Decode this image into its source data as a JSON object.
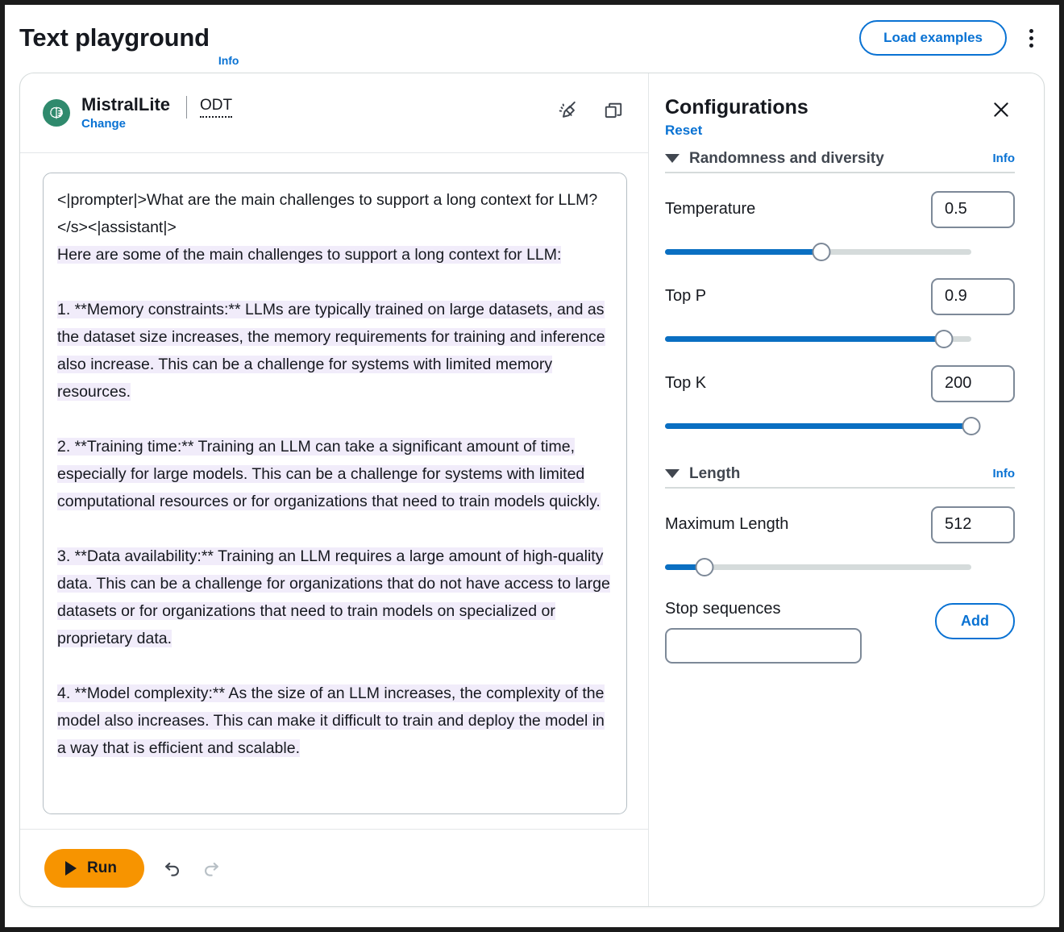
{
  "header": {
    "title": "Text playground",
    "info_label": "Info",
    "load_examples_label": "Load examples",
    "kebab_icon": "more-vertical-icon"
  },
  "model": {
    "icon": "model-brain-icon",
    "name": "MistralLite",
    "change_label": "Change",
    "badge": "ODT",
    "clear_icon": "broom-icon",
    "copy_icon": "copy-icon"
  },
  "editor": {
    "prompt_lines": [
      "<|prompter|>What are the main challenges to support a long context for LLM?</s><|assistant|>"
    ],
    "completion_paragraphs": [
      " Here are some of the main challenges to support a long context for LLM:",
      "1. **Memory constraints:** LLMs are typically trained on large datasets, and as the dataset size increases, the memory requirements for training and inference also increase. This can be a challenge for systems with limited memory resources.",
      "2. **Training time:** Training an LLM can take a significant amount of time, especially for large models. This can be a challenge for systems with limited computational resources or for organizations that need to train models quickly.",
      "3. **Data availability:** Training an LLM requires a large amount of high-quality data. This can be a challenge for organizations that do not have access to large datasets or for organizations that need to train models on specialized or proprietary data.",
      "4. **Model complexity:** As the size of an LLM increases, the complexity of the model also increases. This can make it difficult to train and deploy the model in a way that is efficient and scalable."
    ],
    "highlight_color": "#f1ecfa"
  },
  "run_bar": {
    "run_label": "Run",
    "run_color": "#f79400",
    "undo_icon": "undo-icon",
    "redo_icon": "redo-icon"
  },
  "configurations": {
    "title": "Configurations",
    "reset_label": "Reset",
    "close_icon": "close-icon",
    "sections": [
      {
        "label": "Randomness and diversity",
        "info_label": "Info",
        "controls": [
          {
            "label": "Temperature",
            "value": "0.5",
            "slider_percent": 51
          },
          {
            "label": "Top P",
            "value": "0.9",
            "slider_percent": 91
          },
          {
            "label": "Top K",
            "value": "200",
            "slider_percent": 100
          }
        ]
      },
      {
        "label": "Length",
        "info_label": "Info",
        "controls": [
          {
            "label": "Maximum Length",
            "value": "512",
            "slider_percent": 13
          }
        ],
        "stop_sequences": {
          "label": "Stop sequences",
          "value": "",
          "add_label": "Add"
        }
      }
    ],
    "accent_color": "#0972d3",
    "slider_fill_color": "#0a6fc2"
  }
}
